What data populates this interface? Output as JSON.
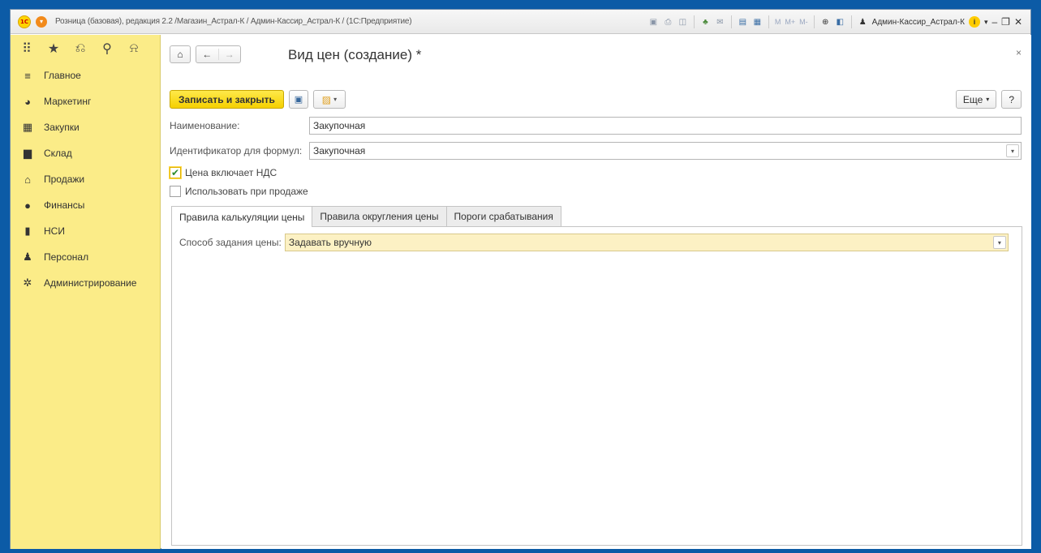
{
  "titlebar": {
    "text": "Розница (базовая), редакция 2.2 /Магазин_Астрал-К / Админ-Кассир_Астрал-К / (1С:Предприятие)",
    "logo": "1С",
    "m_label": "M",
    "mplus_label": "M+",
    "mminus_label": "M-",
    "user": "Админ-Кассир_Астрал-К",
    "info_icon": "i",
    "minimize": "–",
    "restore": "❐",
    "close": "✕"
  },
  "sidebar": {
    "top_icons": [
      "grid-icon",
      "star-icon",
      "history-icon",
      "search-icon",
      "bell-icon"
    ],
    "items": [
      {
        "label": "Главное",
        "icon": "≡"
      },
      {
        "label": "Маркетинг",
        "icon": "◕"
      },
      {
        "label": "Закупки",
        "icon": "▦"
      },
      {
        "label": "Склад",
        "icon": "▆"
      },
      {
        "label": "Продажи",
        "icon": "⌂"
      },
      {
        "label": "Финансы",
        "icon": "●"
      },
      {
        "label": "НСИ",
        "icon": "▮"
      },
      {
        "label": "Персонал",
        "icon": "♟"
      },
      {
        "label": "Администрирование",
        "icon": "✲"
      }
    ]
  },
  "form": {
    "title": "Вид цен (создание) *",
    "close": "×",
    "save_close": "Записать и закрыть",
    "more": "Еще",
    "help": "?",
    "name_label": "Наименование:",
    "name_value": "Закупочная",
    "formula_label": "Идентификатор для формул:",
    "formula_value": "Закупочная",
    "vat_label": "Цена включает НДС",
    "vat_checked": true,
    "sale_label": "Использовать при продаже",
    "sale_checked": false,
    "tabs": [
      {
        "label": "Правила калькуляции цены",
        "active": true
      },
      {
        "label": "Правила округления цены",
        "active": false
      },
      {
        "label": "Пороги срабатывания",
        "active": false
      }
    ],
    "price_method_label": "Способ задания цены:",
    "price_method_value": "Задавать вручную"
  },
  "colors": {
    "accent_yellow": "#f5d000",
    "sidebar_bg": "#fbec88",
    "frame_blue": "#0c5ba6"
  }
}
